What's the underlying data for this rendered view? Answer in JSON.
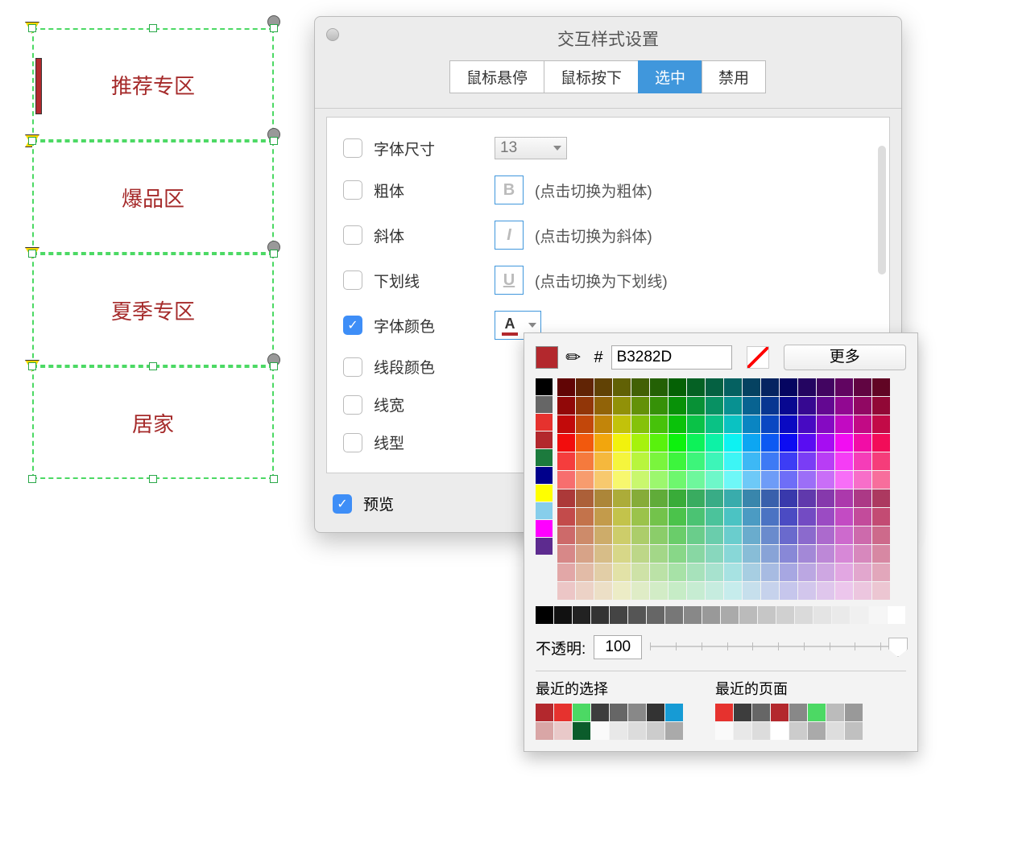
{
  "canvas": {
    "items": [
      "推荐专区",
      "爆品区",
      "夏季专区",
      "居家"
    ]
  },
  "dialog": {
    "title": "交互样式设置",
    "tabs": [
      "鼠标悬停",
      "鼠标按下",
      "选中",
      "禁用"
    ],
    "active_tab": "选中",
    "rows": {
      "font_size": {
        "label": "字体尺寸",
        "value": "13"
      },
      "bold": {
        "label": "粗体",
        "hint": "(点击切换为粗体)",
        "btn": "B"
      },
      "italic": {
        "label": "斜体",
        "hint": "(点击切换为斜体)",
        "btn": "I"
      },
      "underline": {
        "label": "下划线",
        "hint": "(点击切换为下划线)",
        "btn": "U"
      },
      "font_color": {
        "label": "字体颜色",
        "btn": "A"
      },
      "line_color": {
        "label": "线段颜色"
      },
      "line_width": {
        "label": "线宽"
      },
      "line_style": {
        "label": "线型"
      }
    },
    "preview": "预览"
  },
  "picker": {
    "hex": "B3282D",
    "more": "更多",
    "opacity_label": "不透明:",
    "opacity": "100",
    "recent_choice_label": "最近的选择",
    "recent_page_label": "最近的页面",
    "left_colors": [
      "#000",
      "#666",
      "#e6322e",
      "#b3282d",
      "#1c7a3d",
      "#00008b",
      "#ffff00",
      "#87ceeb",
      "#ff00ff",
      "#5d2b8f"
    ],
    "gray": [
      "#000",
      "#111",
      "#222",
      "#333",
      "#444",
      "#555",
      "#666",
      "#777",
      "#888",
      "#999",
      "#aaa",
      "#bbb",
      "#c6c6c6",
      "#d0d0d0",
      "#dadada",
      "#e4e4e4",
      "#eaeaea",
      "#f0f0f0",
      "#f6f6f6",
      "#fff"
    ],
    "recent_choice": [
      [
        "#b3282d",
        "#e6322e",
        "#4cd964",
        "#3d3d3d",
        "#666",
        "#888",
        "#333",
        "#169bd5"
      ],
      [
        "#d9a6a6",
        "#e9c9c9",
        "#0b5c2b",
        "#fafafa",
        "#e8e8e8",
        "#dcdcdc",
        "#ccc",
        "#aaa"
      ]
    ],
    "recent_page": [
      [
        "#e6322e",
        "#3d3d3d",
        "#666",
        "#b3282d",
        "#888",
        "#4cd964",
        "#bbb",
        "#999"
      ],
      [
        "#fafafa",
        "#e8e8e8",
        "#dcdcdc",
        "#fff",
        "#ccc",
        "#aaa",
        "#ddd",
        "#c0c0c0"
      ]
    ]
  }
}
